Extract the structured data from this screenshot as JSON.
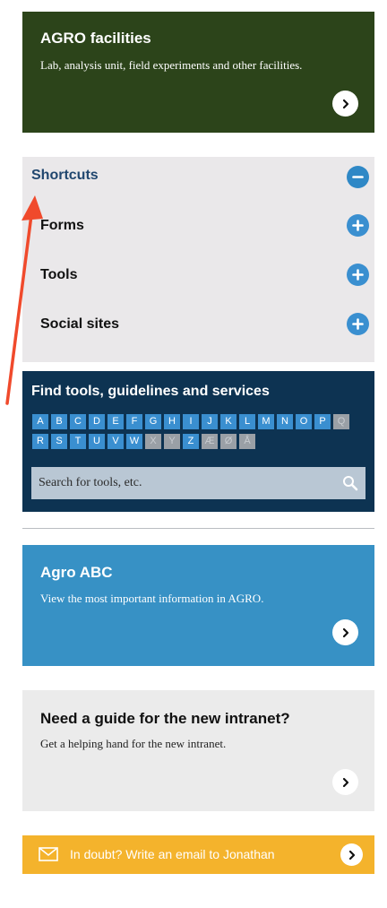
{
  "facilities": {
    "title": "AGRO facilities",
    "description": "Lab, analysis unit, field experiments and other facilities."
  },
  "shortcuts": {
    "title": "Shortcuts",
    "items": [
      {
        "label": "Forms"
      },
      {
        "label": "Tools"
      },
      {
        "label": "Social sites"
      }
    ]
  },
  "find_tools": {
    "title": "Find tools, guidelines and services",
    "letters_row1": [
      "A",
      "B",
      "C",
      "D",
      "E",
      "F",
      "G",
      "H",
      "I",
      "J",
      "K",
      "L",
      "M",
      "N",
      "O",
      "P",
      "Q"
    ],
    "letters_row2": [
      "R",
      "S",
      "T",
      "U",
      "V",
      "W",
      "X",
      "Y",
      "Z",
      "Æ",
      "Ø",
      "Å"
    ],
    "disabled_letters": [
      "Q",
      "X",
      "Y",
      "Æ",
      "Ø",
      "Å"
    ],
    "search_placeholder": "Search for tools, etc."
  },
  "agro_abc": {
    "title": "Agro ABC",
    "description": "View the most important information in AGRO."
  },
  "guide": {
    "title": "Need a guide for the new intranet?",
    "description": "Get a helping hand for the new intranet."
  },
  "email": {
    "text": "In doubt? Write an email to Jonathan"
  },
  "colors": {
    "facilities_bg": "#2c441a",
    "shortcuts_bg": "#eae8ea",
    "findtools_bg": "#0d3352",
    "agroabc_bg": "#3791c5",
    "guide_bg": "#ebebeb",
    "email_bg": "#f4b32c",
    "accent_blue": "#3a8fd0",
    "annotation_red": "#f04a2c"
  },
  "icons": [
    "chevron-right-icon",
    "minus-circle-icon",
    "plus-circle-icon",
    "search-icon",
    "mail-icon",
    "annotation-arrow"
  ]
}
